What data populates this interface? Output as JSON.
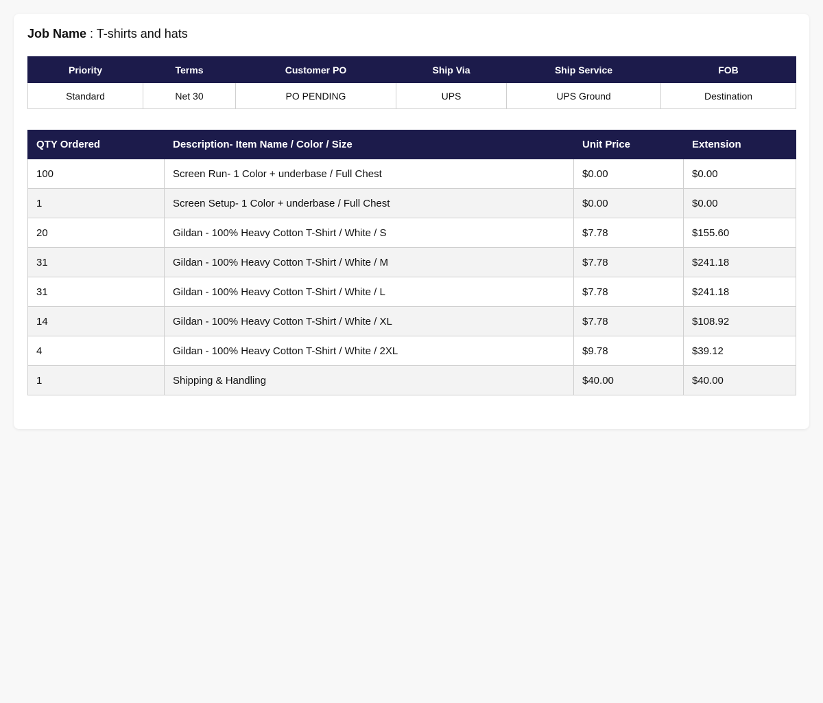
{
  "job": {
    "label": "Job Name",
    "separator": " : ",
    "value": "T-shirts and hats"
  },
  "order_info": {
    "headers": [
      "Priority",
      "Terms",
      "Customer PO",
      "Ship Via",
      "Ship Service",
      "FOB"
    ],
    "values": [
      "Standard",
      "Net 30",
      "PO PENDING",
      "UPS",
      "UPS Ground",
      "Destination"
    ]
  },
  "items": {
    "headers": [
      "QTY Ordered",
      "Description- Item Name / Color / Size",
      "Unit Price",
      "Extension"
    ],
    "rows": [
      [
        "100",
        "Screen Run- 1 Color + underbase / Full Chest",
        "$0.00",
        "$0.00"
      ],
      [
        "1",
        "Screen Setup- 1 Color + underbase / Full Chest",
        "$0.00",
        "$0.00"
      ],
      [
        "20",
        "Gildan - 100% Heavy Cotton T-Shirt / White / S",
        "$7.78",
        "$155.60"
      ],
      [
        "31",
        "Gildan - 100% Heavy Cotton T-Shirt / White / M",
        "$7.78",
        "$241.18"
      ],
      [
        "31",
        "Gildan - 100% Heavy Cotton T-Shirt / White / L",
        "$7.78",
        "$241.18"
      ],
      [
        "14",
        "Gildan - 100% Heavy Cotton T-Shirt / White / XL",
        "$7.78",
        "$108.92"
      ],
      [
        "4",
        "Gildan - 100% Heavy Cotton T-Shirt / White / 2XL",
        "$9.78",
        "$39.12"
      ],
      [
        "1",
        "Shipping & Handling",
        "$40.00",
        "$40.00"
      ]
    ]
  },
  "colors": {
    "header_bg": "#1c1b4b",
    "header_text": "#ffffff",
    "row_alt_bg": "#f3f3f3"
  }
}
